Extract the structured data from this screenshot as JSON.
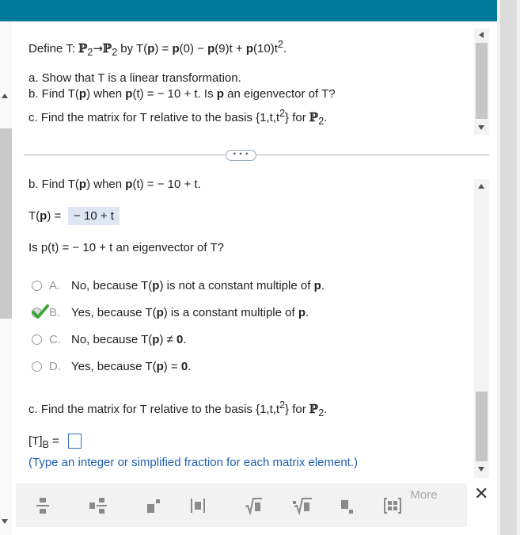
{
  "question": {
    "define_prefix": "Define T: ",
    "define_P": "ℙ",
    "define_sub1": "2",
    "define_arrow": "→",
    "define_sub2": "2",
    "define_by": " by T(",
    "define_p1": "p",
    "define_eq": ") = ",
    "define_p2": "p",
    "define_mid": "(0) − ",
    "define_p3": "p",
    "define_mid2": "(9)t + ",
    "define_p4": "p",
    "define_end": "(10)t",
    "define_sup": "2",
    "define_period": ".",
    "part_a": "a. Show that T is a linear transformation.",
    "part_b_prefix": "b. Find T(",
    "part_b_p1": "p",
    "part_b_mid": ") when ",
    "part_b_p2": "p",
    "part_b_mid2": "(t) =  − 10 + t. Is ",
    "part_b_p3": "p",
    "part_b_end": " an eigenvector of T?",
    "part_c_prefix": "c. Find the matrix for T relative to the basis {1,t,t",
    "part_c_sup": "2",
    "part_c_mid": "} for ",
    "part_c_P": "ℙ",
    "part_c_sub": "2",
    "part_c_end": "."
  },
  "divider": {
    "more_label": "• • •"
  },
  "part_b": {
    "heading_prefix": "b. Find T(",
    "heading_p1": "p",
    "heading_mid": ") when ",
    "heading_p2": "p",
    "heading_end": "(t) =  − 10 + t.",
    "answer_label_prefix": "T(",
    "answer_label_p": "p",
    "answer_label_end": ") = ",
    "answer_value": " − 10 + t",
    "eigen_question": "Is p(t) =  − 10 + t an eigenvector of T?",
    "options": [
      {
        "letter": "A.",
        "text_prefix": "No, because T(",
        "p1": "p",
        "text_mid": ") is not a constant multiple of ",
        "p2": "p",
        "text_end": "."
      },
      {
        "letter": "B.",
        "text_prefix": "Yes, because T(",
        "p1": "p",
        "text_mid": ") is a constant multiple of ",
        "p2": "p",
        "text_end": "."
      },
      {
        "letter": "C.",
        "text_prefix": "No, because T(",
        "p1": "p",
        "text_mid": ") ≠ ",
        "p2": "0",
        "text_end": "."
      },
      {
        "letter": "D.",
        "text_prefix": "Yes, because T(",
        "p1": "p",
        "text_mid": ") = ",
        "p2": "0",
        "text_end": "."
      }
    ],
    "selected_option": "B."
  },
  "part_c": {
    "heading_prefix": "c. Find the matrix for T relative to the basis {1,t,t",
    "heading_sup": "2",
    "heading_mid": "} for ",
    "heading_P": "ℙ",
    "heading_sub": "2",
    "heading_end": ".",
    "matrix_label": "[T]",
    "matrix_sub": "B",
    "matrix_eq": " = ",
    "hint": "(Type an integer or simplified fraction for each matrix element.)"
  },
  "toolbar": {
    "buttons": [
      "fraction-icon",
      "mixed-number-icon",
      "exponent-icon",
      "absolute-value-icon",
      "square-root-icon",
      "nth-root-icon",
      "subscript-icon",
      "matrix-icon"
    ],
    "more_label": "More",
    "close_label": "✕"
  },
  "colors": {
    "topbar": "#00799a",
    "answer_box": "#dde6f2",
    "hint": "#1f5fb0",
    "check": "#3aa63a"
  }
}
